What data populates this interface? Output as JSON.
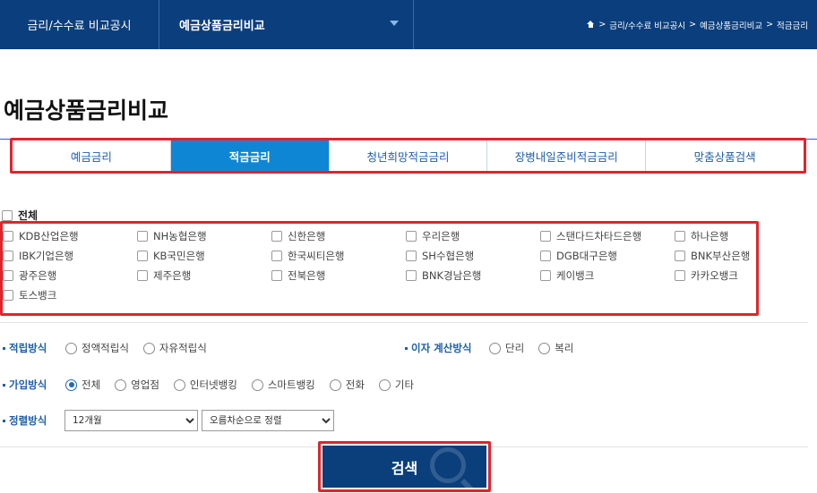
{
  "topbar": {
    "menu1": "금리/수수료 비교공시",
    "menu2": "예금상품금리비교",
    "breadcrumb": [
      "금리/수수료 비교공시",
      "예금상품금리비교",
      "적금금리"
    ]
  },
  "page_title": "예금상품금리비교",
  "tabs": [
    {
      "label": "예금금리",
      "active": false
    },
    {
      "label": "적금금리",
      "active": true
    },
    {
      "label": "청년희망적금금리",
      "active": false
    },
    {
      "label": "장병내일준비적금금리",
      "active": false
    },
    {
      "label": "맞춤상품검색",
      "active": false
    }
  ],
  "select_all_label": "전체",
  "banks": [
    "KDB산업은행",
    "NH농협은행",
    "신한은행",
    "우리은행",
    "스탠다드차타드은행",
    "하나은행",
    "IBK기업은행",
    "KB국민은행",
    "한국씨티은행",
    "SH수협은행",
    "DGB대구은행",
    "BNK부산은행",
    "광주은행",
    "제주은행",
    "전북은행",
    "BNK경남은행",
    "케이뱅크",
    "카카오뱅크",
    "토스뱅크"
  ],
  "savings_method": {
    "label": "적립방식",
    "options": [
      "정액적립식",
      "자유적립식"
    ]
  },
  "interest_method": {
    "label": "이자 계산방식",
    "options": [
      "단리",
      "복리"
    ]
  },
  "join_method": {
    "label": "가입방식",
    "options": [
      "전체",
      "영업점",
      "인터넷뱅킹",
      "스마트뱅킹",
      "전화",
      "기타"
    ],
    "selected": "전체"
  },
  "sort_method": {
    "label": "정렬방식",
    "period_value": "12개월",
    "order_value": "오름차순으로 정렬"
  },
  "search_label": "검색",
  "colors": {
    "navy": "#0b3e7c",
    "tab_active": "#0f86d4",
    "highlight_red": "#e0242c",
    "label_blue": "#1f5fa8"
  }
}
